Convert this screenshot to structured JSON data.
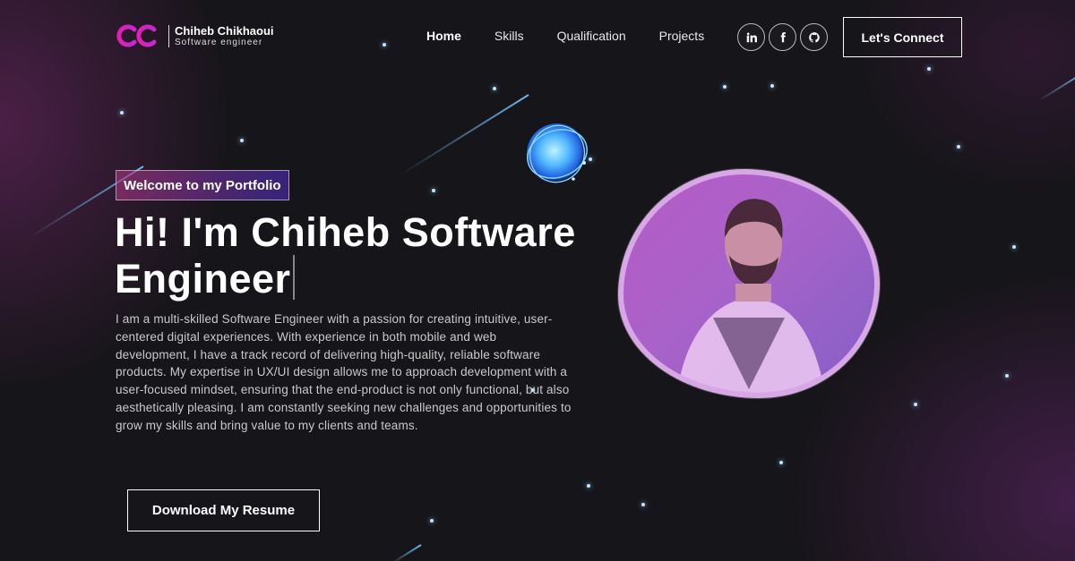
{
  "brand": {
    "name": "Chiheb Chikhaoui",
    "subtitle": "Software engineer",
    "logo_icon": "cc-logo-icon",
    "gradient_start": "#d11fb6",
    "gradient_end": "#6d3ee8"
  },
  "nav": {
    "items": [
      {
        "label": "Home",
        "active": true
      },
      {
        "label": "Skills",
        "active": false
      },
      {
        "label": "Qualification",
        "active": false
      },
      {
        "label": "Projects",
        "active": false
      }
    ]
  },
  "socials": [
    {
      "icon": "linkedin-icon",
      "label": "in"
    },
    {
      "icon": "facebook-icon",
      "label": "f"
    },
    {
      "icon": "github-icon",
      "label": ""
    }
  ],
  "header": {
    "connect_label": "Let's Connect"
  },
  "hero": {
    "tagline": "Welcome to my Portfolio",
    "title": "Hi! I'm Chiheb Software Engineer",
    "bio": "I am a multi-skilled Software Engineer with a passion for creating intuitive, user-centered digital experiences. With experience in both mobile and web development, I have a track record of delivering high-quality, reliable software products. My expertise in UX/UI design allows me to approach development with a user-focused mindset, ensuring that the end-product is not only functional, but also aesthetically pleasing. I am constantly seeking new challenges and opportunities to grow my skills and bring value to my clients and teams.",
    "resume_label": "Download My Resume"
  },
  "colors": {
    "background": "#161519",
    "accent_pink": "#aa367c",
    "accent_purple": "#4a2fbd",
    "star": "#bfe6ff"
  }
}
